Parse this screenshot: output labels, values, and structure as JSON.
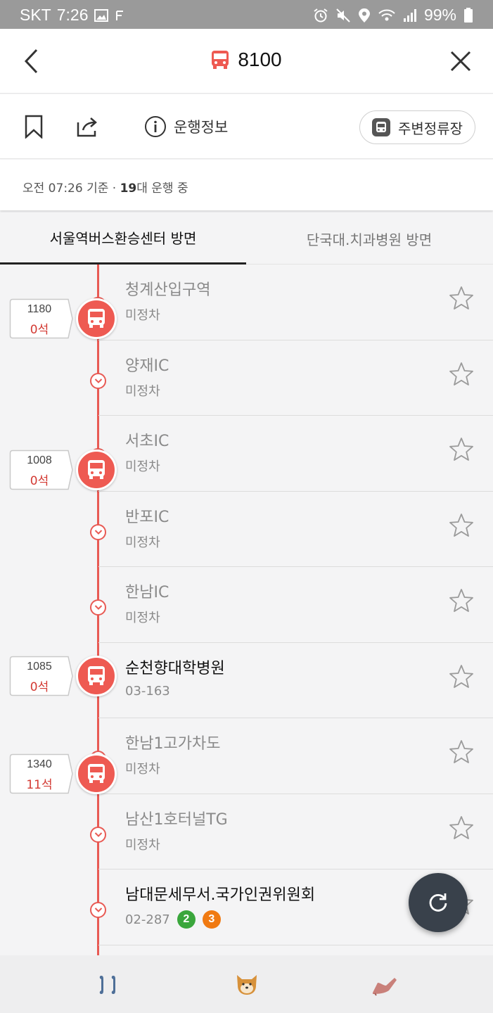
{
  "status_bar": {
    "carrier": "SKT",
    "time": "7:26",
    "battery": "99%",
    "icons": [
      "image-icon",
      "f-icon",
      "alarm-icon",
      "mute-icon",
      "location-icon",
      "wifi-icon",
      "signal-icon",
      "battery-icon"
    ]
  },
  "header": {
    "route_number": "8100",
    "route_color": "#ee5a52"
  },
  "toolbar": {
    "info_label": "운행정보",
    "nearby_label": "주변정류장"
  },
  "base_info": {
    "prefix": "오전 07:26 기준 · ",
    "bus_count": "19",
    "suffix": "대 운행 중"
  },
  "tabs": [
    {
      "label": "서울역버스환승센터 방면",
      "active": true
    },
    {
      "label": "단국대.치과병원 방면",
      "active": false
    }
  ],
  "stops": [
    {
      "name": "청계산입구역",
      "sub": "미정차",
      "highlight": false,
      "badges": []
    },
    {
      "name": "양재IC",
      "sub": "미정차",
      "highlight": false,
      "badges": []
    },
    {
      "name": "서초IC",
      "sub": "미정차",
      "highlight": false,
      "badges": []
    },
    {
      "name": "반포IC",
      "sub": "미정차",
      "highlight": false,
      "badges": []
    },
    {
      "name": "한남IC",
      "sub": "미정차",
      "highlight": false,
      "badges": []
    },
    {
      "name": "순천향대학병원",
      "sub": "03-163",
      "highlight": true,
      "badges": []
    },
    {
      "name": "한남1고가차도",
      "sub": "미정차",
      "highlight": false,
      "badges": []
    },
    {
      "name": "남산1호터널TG",
      "sub": "미정차",
      "highlight": false,
      "badges": []
    },
    {
      "name": "남대문세무서.국가인권위원회",
      "sub": "02-287",
      "highlight": true,
      "badges": [
        {
          "text": "2",
          "color": "#3aa63c"
        },
        {
          "text": "3",
          "color": "#f07a12"
        }
      ]
    }
  ],
  "buses": [
    {
      "number": "1180",
      "seats": "0석"
    },
    {
      "number": "1008",
      "seats": "0석"
    },
    {
      "number": "1085",
      "seats": "0석"
    },
    {
      "number": "1340",
      "seats": "11석"
    }
  ],
  "colors": {
    "accent": "#ee5a52",
    "fab": "#39414b"
  }
}
